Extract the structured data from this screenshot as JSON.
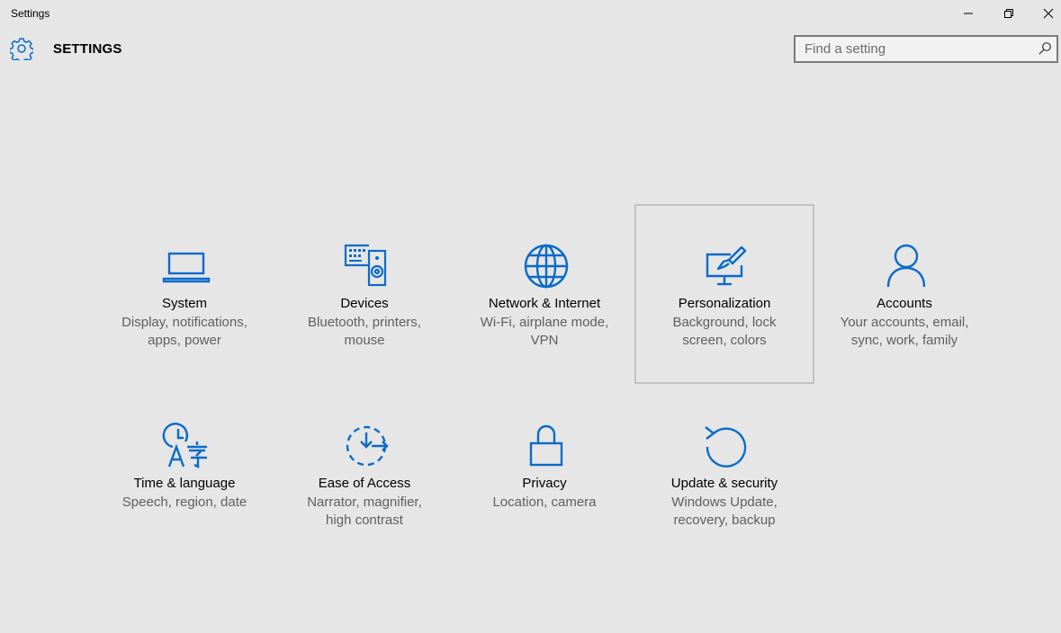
{
  "window": {
    "title": "Settings"
  },
  "header": {
    "title": "SETTINGS",
    "search_placeholder": "Find a setting"
  },
  "tiles": [
    {
      "label": "System",
      "desc": [
        "Display, notifications,",
        "apps, power"
      ],
      "icon": "laptop-icon"
    },
    {
      "label": "Devices",
      "desc": [
        "Bluetooth, printers,",
        "mouse"
      ],
      "icon": "keyboard-speaker-icon"
    },
    {
      "label": "Network & Internet",
      "desc": [
        "Wi-Fi, airplane mode,",
        "VPN"
      ],
      "icon": "globe-icon"
    },
    {
      "label": "Personalization",
      "desc": [
        "Background, lock",
        "screen, colors"
      ],
      "icon": "monitor-brush-icon"
    },
    {
      "label": "Accounts",
      "desc": [
        "Your accounts, email,",
        "sync, work, family"
      ],
      "icon": "person-icon"
    },
    {
      "label": "Time & language",
      "desc": [
        "Speech, region, date"
      ],
      "icon": "clock-language-icon"
    },
    {
      "label": "Ease of Access",
      "desc": [
        "Narrator, magnifier,",
        "high contrast"
      ],
      "icon": "ease-of-access-icon"
    },
    {
      "label": "Privacy",
      "desc": [
        "Location, camera"
      ],
      "icon": "lock-icon"
    },
    {
      "label": "Update & security",
      "desc": [
        "Windows Update,",
        "recovery, backup"
      ],
      "icon": "refresh-icon"
    }
  ],
  "colors": {
    "accent": "#0a6bc9",
    "background": "#e6e6e6"
  }
}
